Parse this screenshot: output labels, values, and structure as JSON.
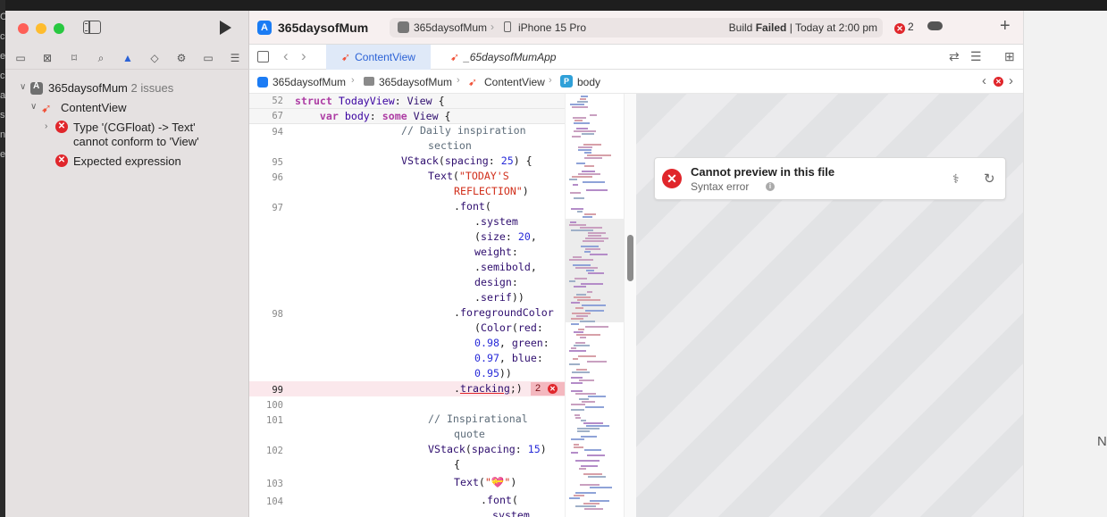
{
  "toolbar": {
    "project_name": "365daysofMum",
    "scheme_target": "365daysofMum",
    "device": "iPhone 15 Pro",
    "status_prefix": "Build",
    "status_bold": "Failed",
    "status_suffix": " | Today at 2:00 pm",
    "error_count": "2"
  },
  "navigator": {
    "project": "365daysofMum",
    "issue_count": "2 issues",
    "file": "ContentView",
    "issue1_line1": "Type '(CGFloat) -> Text'",
    "issue1_line2": "cannot conform to 'View'",
    "issue2": "Expected expression"
  },
  "tabs": {
    "active": "ContentView",
    "second": "_65daysofMumApp"
  },
  "jumpbar": {
    "project": "365daysofMum",
    "group": "365daysofMum",
    "file": "ContentView",
    "symbol": "body",
    "symbol_badge": "P"
  },
  "code": {
    "sticky1_no": "52",
    "sticky2_no": "67",
    "ln94": "94",
    "ln95": "95",
    "ln96": "96",
    "ln97": "97",
    "ln98": "98",
    "ln99": "99",
    "ln100": "100",
    "ln101": "101",
    "ln102": "102",
    "ln103": "103",
    "ln104": "104",
    "error_badge_count": "2"
  },
  "preview": {
    "title": "Cannot preview in this file",
    "subtitle": "Syntax error"
  },
  "background": {
    "right_letter": "N",
    "left_letters": [
      "C",
      "c",
      "e",
      "c",
      "a",
      "s",
      "n",
      "e"
    ]
  },
  "colors": {
    "accent": "#2b62d6",
    "error": "#e0262b",
    "keyword": "#ad3da4",
    "string": "#d12f1b",
    "number": "#272ad8",
    "type": "#3900a0"
  }
}
